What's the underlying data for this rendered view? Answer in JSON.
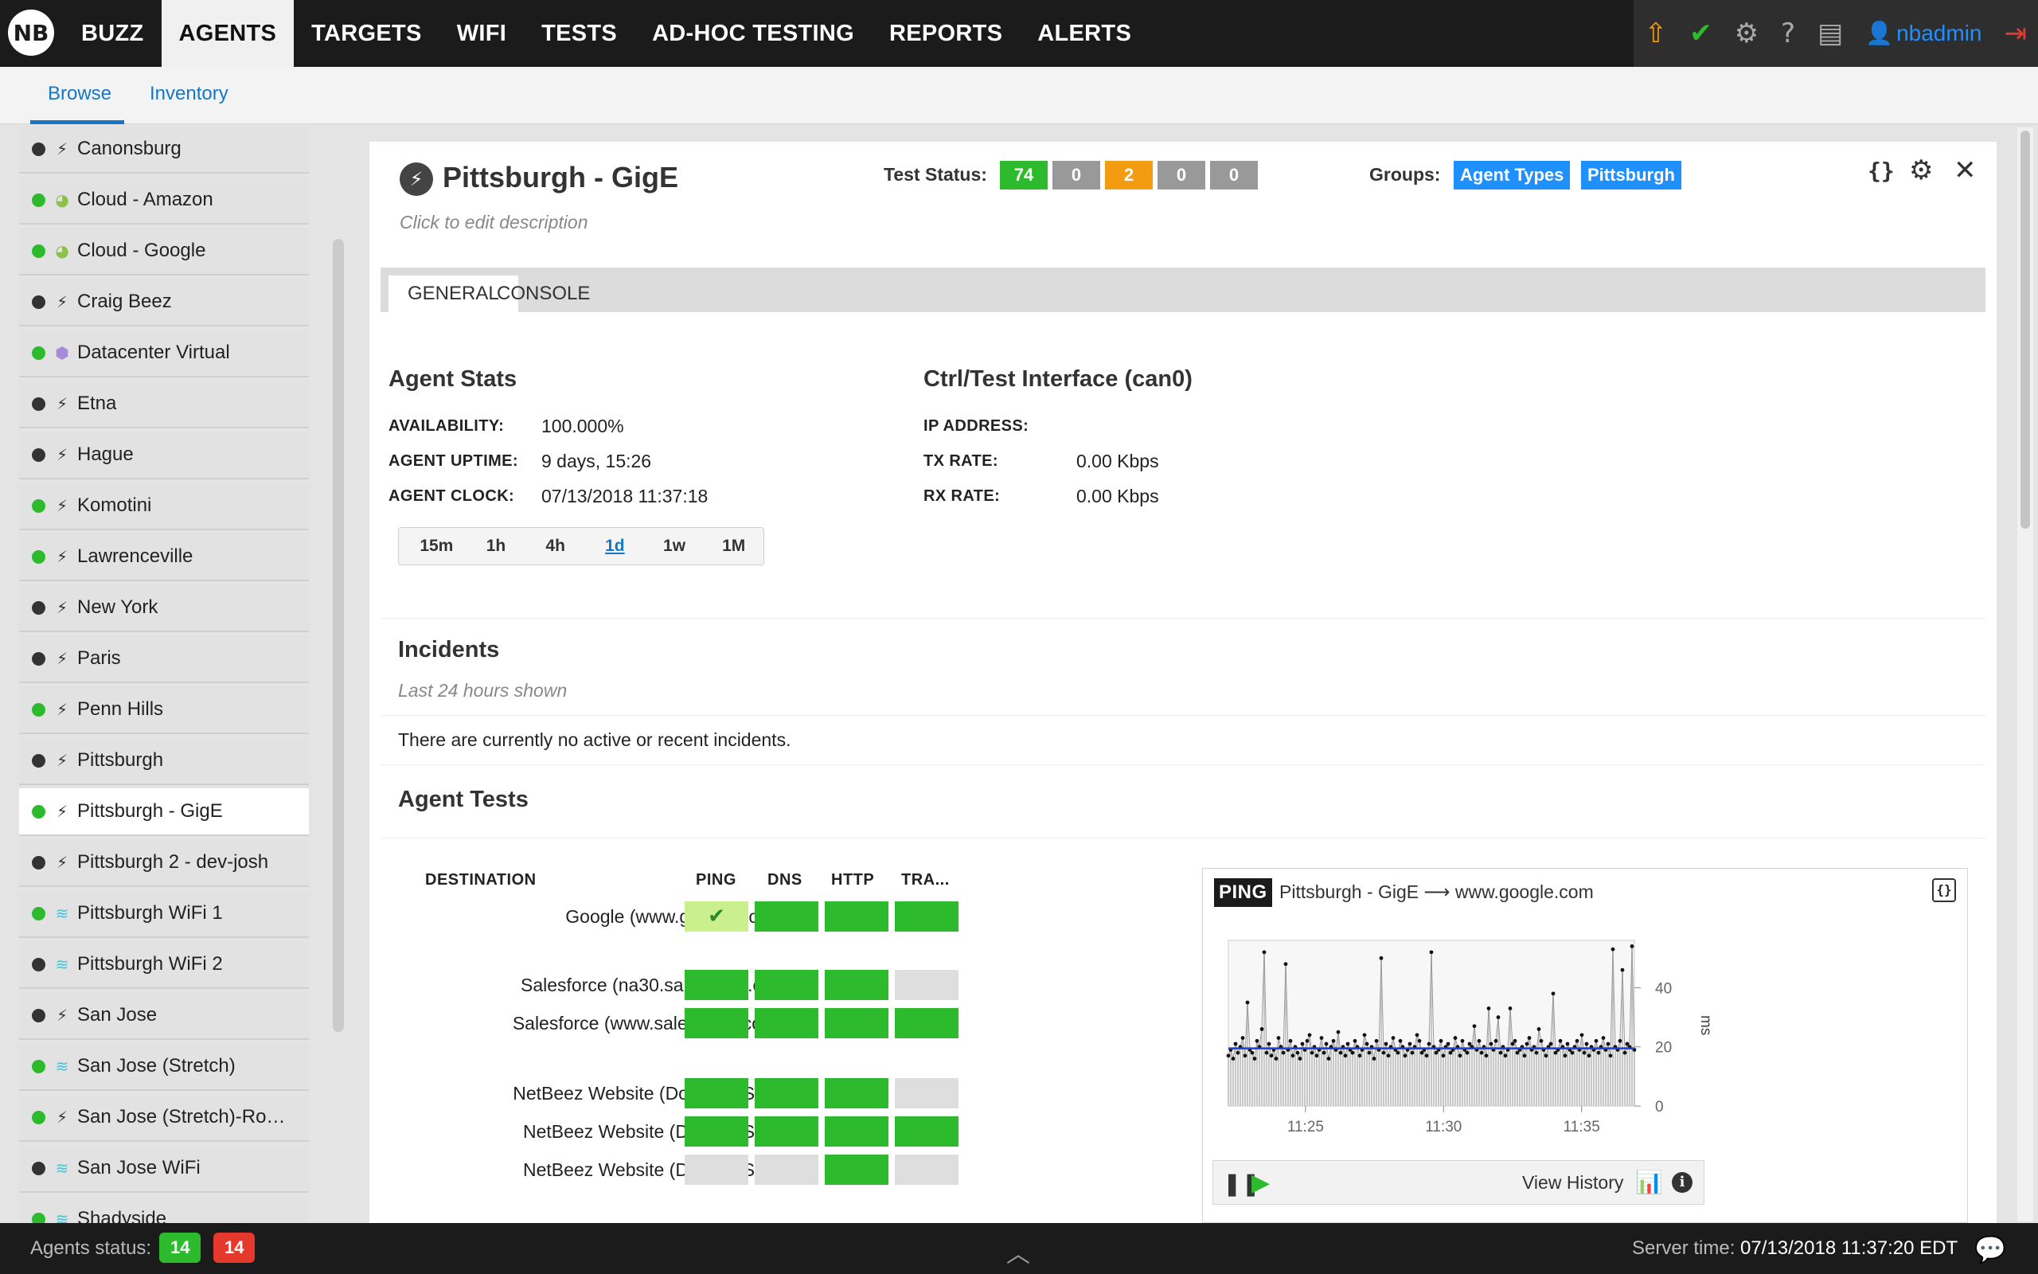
{
  "logo": "NB",
  "nav": {
    "items": [
      "BUZZ",
      "AGENTS",
      "TARGETS",
      "WIFI",
      "TESTS",
      "AD-HOC TESTING",
      "REPORTS",
      "ALERTS"
    ],
    "active": "AGENTS"
  },
  "user": {
    "name": "nbadmin"
  },
  "subnav": {
    "browse": "Browse",
    "inventory": "Inventory"
  },
  "sidebar": {
    "items": [
      {
        "label": "Canonsburg",
        "status": "dark",
        "icon": "plug"
      },
      {
        "label": "Cloud - Amazon",
        "status": "green",
        "icon": "globe"
      },
      {
        "label": "Cloud - Google",
        "status": "green",
        "icon": "globe"
      },
      {
        "label": "Craig Beez",
        "status": "dark",
        "icon": "plug"
      },
      {
        "label": "Datacenter Virtual",
        "status": "green",
        "icon": "cube"
      },
      {
        "label": "Etna",
        "status": "dark",
        "icon": "plug"
      },
      {
        "label": "Hague",
        "status": "dark",
        "icon": "plug"
      },
      {
        "label": "Komotini",
        "status": "green",
        "icon": "plug"
      },
      {
        "label": "Lawrenceville",
        "status": "green",
        "icon": "plug"
      },
      {
        "label": "New York",
        "status": "dark",
        "icon": "plug"
      },
      {
        "label": "Paris",
        "status": "dark",
        "icon": "plug"
      },
      {
        "label": "Penn Hills",
        "status": "green",
        "icon": "plug"
      },
      {
        "label": "Pittsburgh",
        "status": "dark",
        "icon": "plug"
      },
      {
        "label": "Pittsburgh - GigE",
        "status": "green",
        "icon": "plug",
        "selected": true
      },
      {
        "label": "Pittsburgh 2 - dev-josh",
        "status": "dark",
        "icon": "plug"
      },
      {
        "label": "Pittsburgh WiFi 1",
        "status": "green",
        "icon": "wifi"
      },
      {
        "label": "Pittsburgh WiFi 2",
        "status": "dark",
        "icon": "wifi"
      },
      {
        "label": "San Jose",
        "status": "dark",
        "icon": "plug"
      },
      {
        "label": "San Jose (Stretch)",
        "status": "green",
        "icon": "wifi"
      },
      {
        "label": "San Jose (Stretch)-Ro…",
        "status": "green",
        "icon": "plug"
      },
      {
        "label": "San Jose WiFi",
        "status": "dark",
        "icon": "wifi"
      },
      {
        "label": "Shadyside",
        "status": "green",
        "icon": "wifi"
      }
    ]
  },
  "agent": {
    "title": "Pittsburgh - GigE",
    "description": "Click to edit description",
    "test_status_label": "Test Status:",
    "test_status": [
      {
        "value": "74",
        "color": "#2dbb2d"
      },
      {
        "value": "0",
        "color": "#999999"
      },
      {
        "value": "2",
        "color": "#f39c12"
      },
      {
        "value": "0",
        "color": "#999999"
      },
      {
        "value": "0",
        "color": "#999999"
      }
    ],
    "groups_label": "Groups:",
    "groups": [
      "Agent Types",
      "Pittsburgh"
    ]
  },
  "tabs": {
    "general": "GENERAL",
    "console": "CONSOLE"
  },
  "stats": {
    "title": "Agent Stats",
    "availability_label": "AVAILABILITY:",
    "availability": "100.000%",
    "uptime_label": "AGENT UPTIME:",
    "uptime": "9 days, 15:26",
    "clock_label": "AGENT CLOCK:",
    "clock": "07/13/2018 11:37:18"
  },
  "iface": {
    "title": "Ctrl/Test Interface (can0)",
    "ip_label": "IP ADDRESS:",
    "ip": "",
    "tx_label": "TX RATE:",
    "tx": "0.00 Kbps",
    "rx_label": "RX RATE:",
    "rx": "0.00 Kbps"
  },
  "ranges": {
    "items": [
      "15m",
      "1h",
      "4h",
      "1d",
      "1w",
      "1M"
    ],
    "active": "1d"
  },
  "incidents": {
    "title": "Incidents",
    "subtitle": "Last 24 hours shown",
    "empty": "There are currently no active or recent incidents."
  },
  "tests": {
    "title": "Agent Tests",
    "headers": {
      "destination": "DESTINATION",
      "ping": "PING",
      "dns": "DNS",
      "http": "HTTP",
      "tra": "TRA..."
    },
    "rows": [
      {
        "label": "Google (www.google.com)",
        "cells": [
          "check",
          "g",
          "g",
          "g"
        ]
      },
      {
        "label": "Salesforce (na30.salesforce.c…",
        "cells": [
          "g",
          "g",
          "g",
          "e"
        ]
      },
      {
        "label": "Salesforce (www.salesforce.co…",
        "cells": [
          "g",
          "g",
          "g",
          "g"
        ]
      },
      {
        "label": "NetBeez Website (Dot Com Site)",
        "cells": [
          "g",
          "g",
          "g",
          "e"
        ]
      },
      {
        "label": "NetBeez Website (Dot Net Site)",
        "cells": [
          "g",
          "g",
          "g",
          "g"
        ]
      },
      {
        "label": "NetBeez Website (Dot Net Site)",
        "cells": [
          "e",
          "e",
          "g",
          "e"
        ]
      }
    ]
  },
  "ping": {
    "badge": "PING",
    "title": "Pittsburgh - GigE ⟶ www.google.com",
    "view_history": "View History"
  },
  "chart_data": {
    "type": "line",
    "x_ticks": [
      "11:25",
      "11:30",
      "11:35"
    ],
    "y_ticks": [
      "0",
      "20",
      "40"
    ],
    "ylabel": "ms",
    "ylim": [
      0,
      56
    ],
    "average_ms": 19.5,
    "series": [
      {
        "values": [
          17,
          19,
          16,
          21,
          18,
          20,
          23,
          17,
          35,
          19,
          18,
          16,
          22,
          20,
          26,
          52,
          18,
          21,
          17,
          19,
          16,
          23,
          20,
          18,
          48,
          19,
          22,
          17,
          20,
          18,
          16,
          21,
          19,
          22,
          24,
          18,
          20,
          17,
          19,
          23,
          18,
          21,
          16,
          20,
          22,
          19,
          25,
          18,
          20,
          17,
          21,
          19,
          18,
          22,
          20,
          17,
          19,
          24,
          21,
          18,
          20,
          16,
          22,
          19,
          50,
          18,
          21,
          17,
          20,
          23,
          19,
          18,
          22,
          20,
          17,
          19,
          21,
          18,
          20,
          24,
          22,
          18,
          19,
          17,
          21,
          52,
          20,
          18,
          19,
          22,
          17,
          20,
          21,
          18,
          19,
          23,
          20,
          17,
          22,
          19,
          18,
          21,
          20,
          27,
          19,
          22,
          18,
          20,
          17,
          33,
          21,
          19,
          22,
          30,
          18,
          20,
          17,
          19,
          33,
          21,
          22,
          18,
          19,
          20,
          17,
          21,
          23,
          19,
          20,
          18,
          26,
          22,
          19,
          17,
          20,
          21,
          38,
          18,
          19,
          22,
          20,
          17,
          21,
          19,
          18,
          20,
          22,
          19,
          24,
          18,
          21,
          17,
          20,
          19,
          22,
          18,
          20,
          23,
          19,
          21,
          17,
          53,
          20,
          19,
          22,
          46,
          18,
          21,
          20,
          54,
          19
        ]
      }
    ]
  },
  "footer": {
    "agents_label": "Agents status:",
    "up": "14",
    "down": "14",
    "server_label": "Server time:",
    "server_time": "07/13/2018 11:37:20 EDT"
  }
}
